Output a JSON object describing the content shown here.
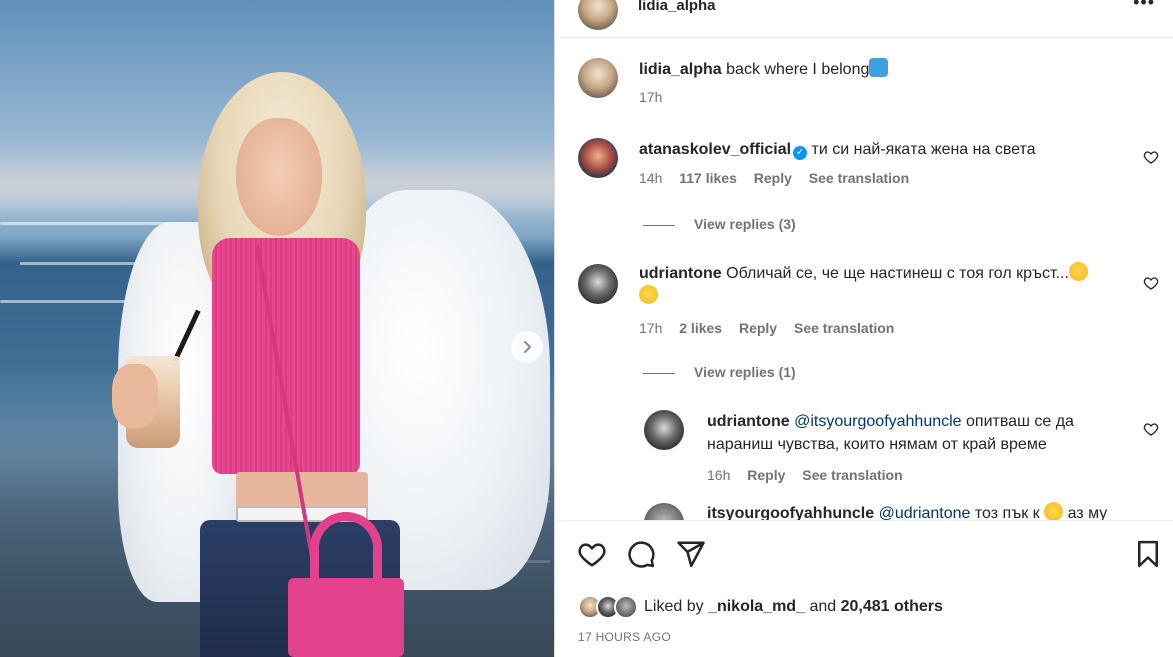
{
  "post": {
    "author": "lidia_alpha",
    "more_label": "•••",
    "caption": {
      "username": "lidia_alpha",
      "text": "back where I belong",
      "emoji": "wave-emoji",
      "time": "17h"
    }
  },
  "comments": [
    {
      "username": "atanaskolev_official",
      "verified": true,
      "text": "ти си най-якaтa жена на света",
      "time": "14h",
      "likes": "117 likes",
      "reply_label": "Reply",
      "translate_label": "See translation",
      "view_replies": "View replies (3)"
    },
    {
      "username": "udriantone",
      "text": "Обличай се, че ще настинеш с тоя гол кръст...",
      "time": "17h",
      "likes": "2 likes",
      "reply_label": "Reply",
      "translate_label": "See translation",
      "view_replies": "View replies (1)",
      "reply": {
        "username": "udriantone",
        "mention": "@itsyourgoofyahhuncle",
        "text": "опитваш се да нараниш чувства, които нямам от край време",
        "time": "16h",
        "reply_label": "Reply",
        "translate_label": "See translation"
      }
    },
    {
      "username": "itsyourgoofyahhuncle",
      "mention": "@udriantone",
      "text": "тоз пък к",
      "text_after": "аз му"
    }
  ],
  "likes": {
    "prefix": "Liked by",
    "user": "_nikola_md_",
    "middle": "and",
    "count": "20,481 others"
  },
  "timestamp": "17 HOURS AGO",
  "colors": {
    "text": "#262626",
    "muted": "#737373",
    "link": "#00376b",
    "verified": "#0095f6",
    "bag_pink": "#e2418c"
  }
}
